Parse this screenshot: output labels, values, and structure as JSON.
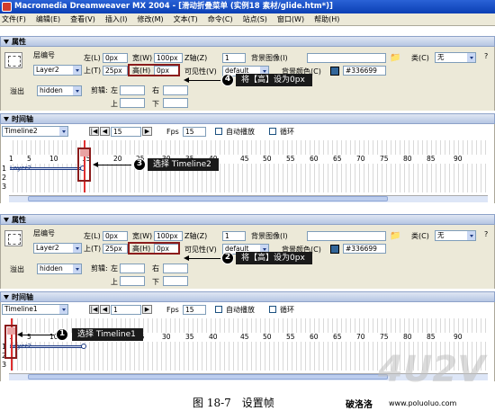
{
  "window": {
    "title": "Macromedia Dreamweaver MX 2004 - [滑动折叠菜单 (实例18 素材/glide.htm*)]"
  },
  "menu": [
    "文件(F)",
    "编辑(E)",
    "查看(V)",
    "插入(I)",
    "修改(M)",
    "文本(T)",
    "命令(C)",
    "站点(S)",
    "窗口(W)",
    "帮助(H)"
  ],
  "top": {
    "props": {
      "title": "属性",
      "layer_id_label": "层编号",
      "layer_id_value": "Layer2",
      "left_label": "左(L)",
      "left_value": "0px",
      "width_label": "宽(W)",
      "width_value": "100px",
      "top_label": "上(T)",
      "top_value": "25px",
      "height_label": "高(H)",
      "height_value": "0px",
      "z_label": "Z轴(Z)",
      "z_value": "1",
      "vis_label": "可见性(V)",
      "vis_value": "default",
      "bgimg_label": "背景图像(I)",
      "bgcolor_label": "背景颜色(C)",
      "bgcolor_value": "#336699",
      "class_label": "类(C)",
      "class_value": "无",
      "overflow_label": "溢出",
      "overflow_value": "hidden",
      "clip_label": "剪辑:",
      "clip_left": "左",
      "clip_right": "右",
      "clip_top": "上",
      "clip_bottom": "下"
    },
    "timeline": {
      "title": "时间轴",
      "name": "Timeline2",
      "frame": "15",
      "fps_label": "Fps",
      "fps": "15",
      "autoplay": "自动播放",
      "loop": "循环",
      "layer_label": "Layer2",
      "ruler": [
        "1",
        "5",
        "10",
        "15",
        "20",
        "25",
        "30",
        "35",
        "40",
        "45",
        "50",
        "55",
        "60",
        "65",
        "70",
        "75",
        "80",
        "85",
        "90"
      ],
      "rows": [
        "1",
        "2",
        "3"
      ]
    },
    "callouts": [
      {
        "num": "4",
        "text": "将【高】设为0px"
      },
      {
        "num": "3",
        "text": "选择 Timeline2"
      }
    ]
  },
  "bottom": {
    "props": {
      "title": "属性",
      "layer_id_label": "层编号",
      "layer_id_value": "Layer2",
      "left_label": "左(L)",
      "left_value": "0px",
      "width_label": "宽(W)",
      "width_value": "100px",
      "top_label": "上(T)",
      "top_value": "25px",
      "height_label": "高(H)",
      "height_value": "0px",
      "z_label": "Z轴(Z)",
      "z_value": "1",
      "vis_label": "可见性(V)",
      "vis_value": "default",
      "bgimg_label": "背景图像(I)",
      "bgcolor_label": "背景颜色(C)",
      "bgcolor_value": "#336699",
      "class_label": "类(C)",
      "class_value": "无",
      "overflow_label": "溢出",
      "overflow_value": "hidden",
      "clip_label": "剪辑:",
      "clip_left": "左",
      "clip_right": "右",
      "clip_top": "上",
      "clip_bottom": "下"
    },
    "timeline": {
      "title": "时间轴",
      "name": "Timeline1",
      "frame": "1",
      "fps_label": "Fps",
      "fps": "15",
      "autoplay": "自动播放",
      "loop": "循环",
      "layer_label": "Layer2",
      "ruler": [
        "1",
        "5",
        "10",
        "15",
        "20",
        "25",
        "30",
        "35",
        "40",
        "45",
        "50",
        "55",
        "60",
        "65",
        "70",
        "75",
        "80",
        "85",
        "90"
      ],
      "rows": [
        "1",
        "2",
        "3"
      ]
    },
    "callouts": [
      {
        "num": "2",
        "text": "将【高】设为0px"
      },
      {
        "num": "1",
        "text": "选择 Timeline1"
      }
    ]
  },
  "caption": "图 18-7　设置帧",
  "site_label": "破洛洛",
  "site_url": "www.poluoluo.com",
  "watermark": "4U2V",
  "colors": {
    "titlebar": "#0a3fb4",
    "panel_bg": "#ece9d8",
    "swatch": "#336699",
    "highlight": "#8b1b1b"
  }
}
